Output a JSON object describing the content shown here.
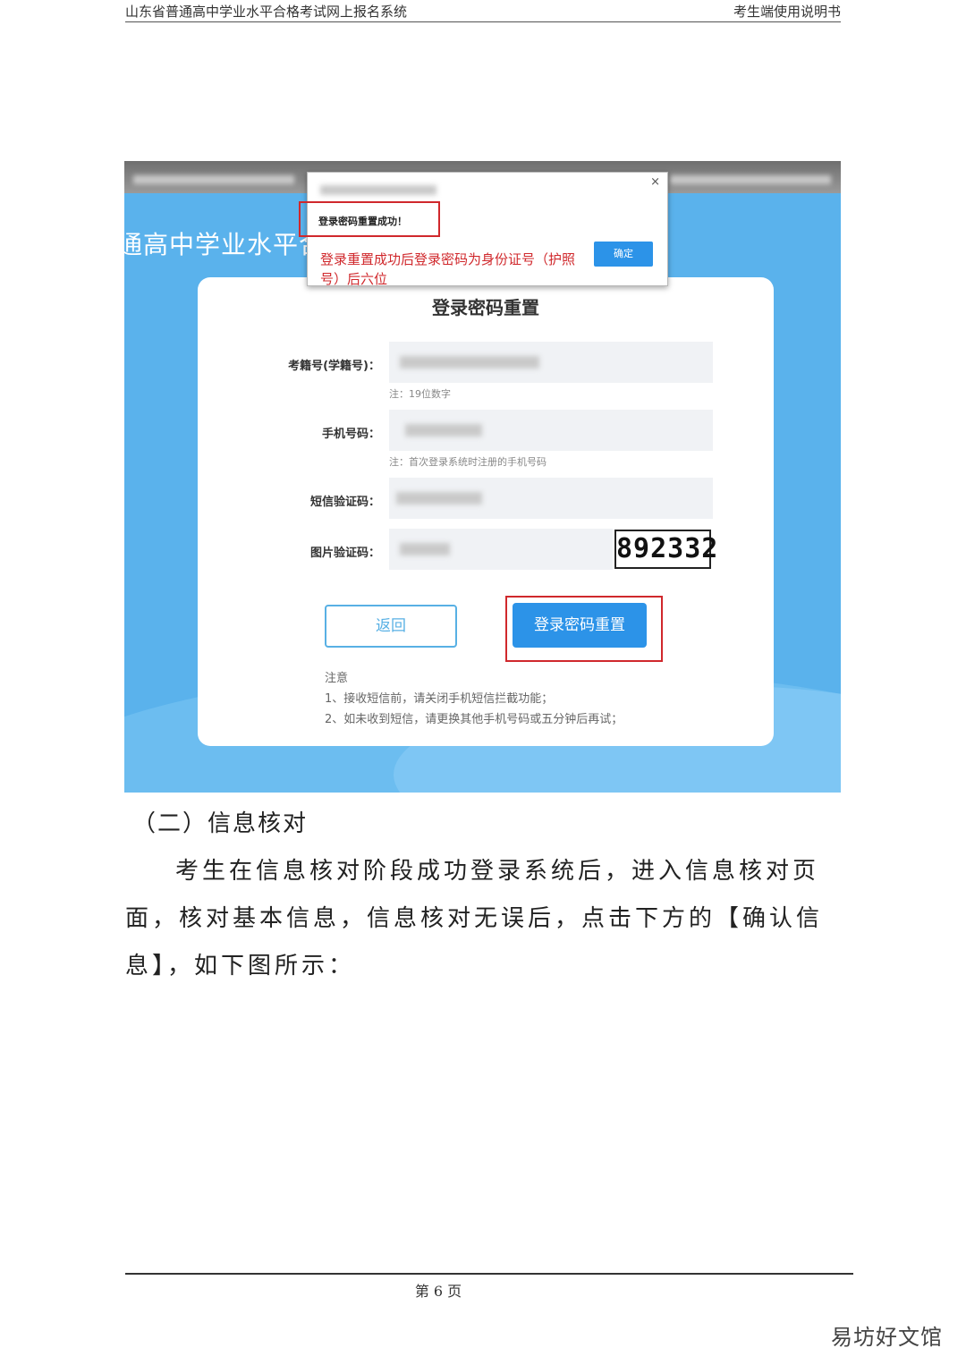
{
  "header": {
    "left": "山东省普通高中学业水平合格考试网上报名系统",
    "right": "考生端使用说明书"
  },
  "screenshot": {
    "site_title": "通高中学业水平合",
    "dialog": {
      "close": "×",
      "message": "登录密码重置成功！",
      "ok_label": "确定",
      "red_tip": "登录重置成功后登录密码为身份证号（护照号）后六位"
    },
    "card": {
      "title": "登录密码重置",
      "fields": [
        {
          "label": "考籍号(学籍号)：",
          "note": "注：19位数字"
        },
        {
          "label": "手机号码：",
          "note": "注：首次登录系统时注册的手机号码"
        },
        {
          "label": "短信验证码：",
          "note": ""
        },
        {
          "label": "图片验证码：",
          "note": ""
        }
      ],
      "captcha": "892332",
      "back_label": "返回",
      "reset_label": "登录密码重置",
      "notes_title": "注意",
      "notes": [
        "1、接收短信前，请关闭手机短信拦截功能；",
        "2、如未收到短信，请更换其他手机号码或五分钟后再试；"
      ]
    }
  },
  "section_heading": "（二）信息核对",
  "paragraph": "考生在信息核对阶段成功登录系统后，进入信息核对页面，核对基本信息，信息核对无误后，点击下方的【确认信息】，如下图所示：",
  "footer": {
    "page": "第 6 页"
  },
  "watermark": "易坊好文馆"
}
